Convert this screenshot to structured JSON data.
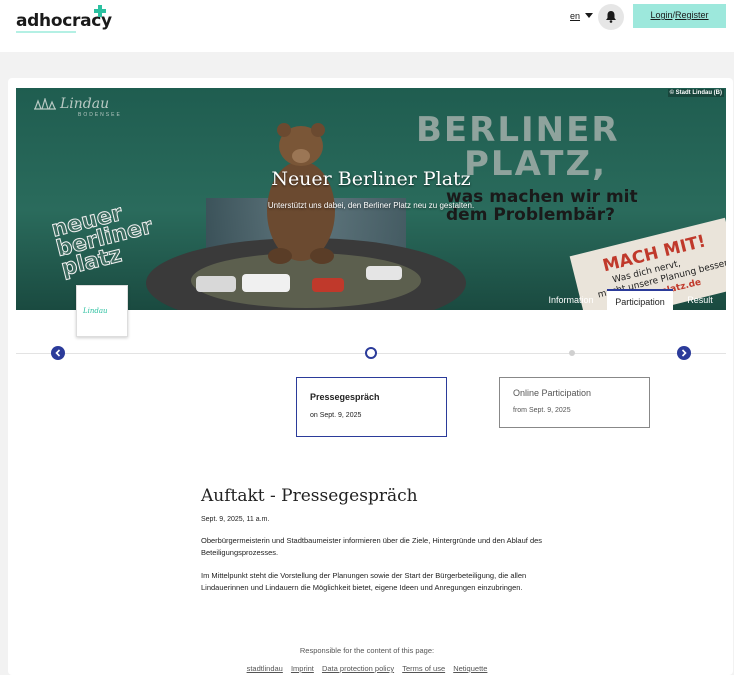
{
  "header": {
    "logo_text": "adhocracy",
    "language": "en",
    "login_label": "Login",
    "separator": "/",
    "register_label": "Register"
  },
  "hero": {
    "copyright": "© Stadt Lindau (B)",
    "title": "Neuer Berliner Platz",
    "subtitle": "Unterstützt uns dabei, den Berliner Platz neu zu gestalten.",
    "brand_logo": "Lindau",
    "brand_sub": "BODENSEE",
    "image_text": {
      "badge_lines": [
        "neuer",
        "berliner",
        "platz"
      ],
      "headline_1": "BERLINER",
      "headline_2": "PLATZ,",
      "headline_3": "was machen wir mit",
      "headline_4": "dem Problembär?",
      "sign_1": "MACH MIT!",
      "sign_2": "Was dich nervt,",
      "sign_3": "macht unsere Planung besser.",
      "sign_4": "berlinerplatz.de"
    }
  },
  "tabs": [
    {
      "label": "Information",
      "active": false
    },
    {
      "label": "Participation",
      "active": true
    },
    {
      "label": "Result",
      "active": false
    }
  ],
  "project_logo": "Lindau",
  "timeline": {
    "phases": [
      {
        "title": "Pressegespräch",
        "date": "on Sept. 9, 2025",
        "active": true
      },
      {
        "title": "Online Participation",
        "date": "from Sept. 9, 2025",
        "active": false
      }
    ]
  },
  "event": {
    "title": "Auftakt - Pressegespräch",
    "date": "Sept. 9, 2025, 11 a.m.",
    "paragraph1": "Oberbürgermeisterin und Stadtbaumeister informieren über die Ziele, Hintergründe und den Ablauf des Beteiligungsprozesses.",
    "paragraph2": "Im Mittelpunkt steht die Vorstellung der Planungen sowie der Start der Bürgerbeteiligung, die allen Lindauerinnen und Lindauern die Möglichkeit bietet, eigene Ideen und Anregungen einzubringen."
  },
  "footer": {
    "responsible_label": "Responsible for the content of this page:",
    "links": [
      "stadtlindau",
      "Imprint",
      "Data protection policy",
      "Terms of use",
      "Netiquette"
    ]
  },
  "colors": {
    "accent": "#2b3b9a",
    "brand": "#2bc0a0",
    "login_bg": "#9de8dc"
  }
}
